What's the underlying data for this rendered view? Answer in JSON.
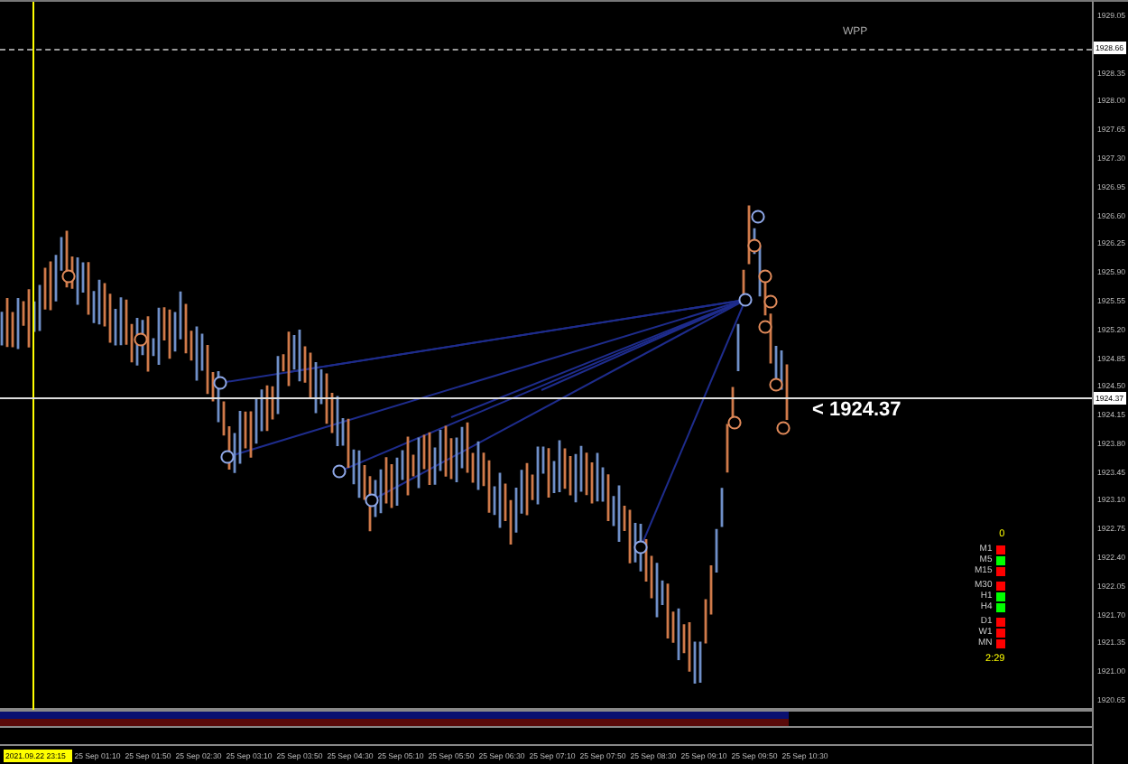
{
  "chart": {
    "pivot_label": "WPP",
    "price_callout": "< 1924.37"
  },
  "price_axis": {
    "ticks": [
      "1929.05",
      "1928.35",
      "1928.00",
      "1927.65",
      "1927.30",
      "1926.95",
      "1926.60",
      "1926.25",
      "1925.90",
      "1925.55",
      "1925.20",
      "1924.85",
      "1924.50",
      "1924.15",
      "1923.80",
      "1923.45",
      "1923.10",
      "1922.75",
      "1922.40",
      "1922.05",
      "1921.70",
      "1921.35",
      "1921.00",
      "1920.65"
    ],
    "markers": [
      {
        "kind": "pivot",
        "label": "1928.66"
      },
      {
        "kind": "bid",
        "label": "1924.37"
      }
    ]
  },
  "timeframe_signals": {
    "header": "0",
    "groups": [
      {
        "items": [
          {
            "label": "M1",
            "color": "#ff0000"
          },
          {
            "label": "M5",
            "color": "#00ff00"
          },
          {
            "label": "M15",
            "color": "#ff0000"
          }
        ]
      },
      {
        "items": [
          {
            "label": "M30",
            "color": "#ff0000"
          },
          {
            "label": "H1",
            "color": "#00ff00"
          },
          {
            "label": "H4",
            "color": "#00ff00"
          }
        ]
      },
      {
        "items": [
          {
            "label": "D1",
            "color": "#ff0000"
          },
          {
            "label": "W1",
            "color": "#ff0000"
          },
          {
            "label": "MN",
            "color": "#ff0000"
          }
        ]
      }
    ],
    "timer": "2:29"
  },
  "time_axis": {
    "cursor_label": "2021.09.22 23:15",
    "labels": [
      "25 Sep 01:10",
      "25 Sep 01:50",
      "25 Sep 02:30",
      "25 Sep 03:10",
      "25 Sep 03:50",
      "25 Sep 04:30",
      "25 Sep 05:10",
      "25 Sep 05:50",
      "25 Sep 06:30",
      "25 Sep 07:10",
      "25 Sep 07:50",
      "25 Sep 08:30",
      "25 Sep 09:10",
      "25 Sep 09:50",
      "25 Sep 10:30"
    ]
  }
}
